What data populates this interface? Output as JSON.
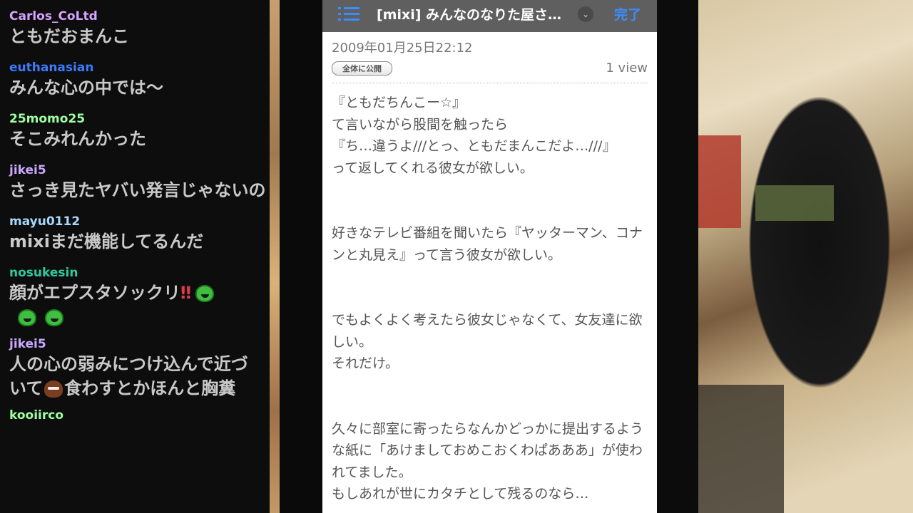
{
  "chat": {
    "messages": [
      {
        "user": "Carlos_CoLtd",
        "color": "#d6a3ff",
        "text": "ともだおまんこ"
      },
      {
        "user": "euthanasian",
        "color": "#3a7bff",
        "text": "みんな心の中では〜"
      },
      {
        "user": "25momo25",
        "color": "#9dffa0",
        "text": "そこみれんかった"
      },
      {
        "user": "jikei5",
        "color": "#c9a8ff",
        "text": "さっき見たヤバい発言じゃないの"
      },
      {
        "user": "mayu0112",
        "color": "#a8d8ff",
        "text": "mixiまだ機能してるんだ"
      },
      {
        "user": "nosukesin",
        "color": "#2fc9a0",
        "text": "顔がエプスタソックリ"
      },
      {
        "user": "jikei5",
        "color": "#c9a8ff",
        "text_a": "人の心の弱みにつけ込んで近づ",
        "text_b": "いて",
        "text_c": "食わすとかほんと胸糞"
      },
      {
        "user": "kooiirco",
        "color": "#9dffa0",
        "text": ""
      }
    ],
    "emote_name": "laughing-green-emote",
    "bang": "‼"
  },
  "phone": {
    "title": "[mixi] みんなのなりた屋さ…",
    "done_label": "完了",
    "date": "2009年01月25日22:12",
    "badge": "全体に公開",
    "views": "1 view",
    "accent": "#3c8cff",
    "paragraphs": [
      "『ともだちんこー☆』\nて言いながら股間を触ったら\n『ち…違うよ///とっ、ともだまんこだよ…///』\nって返してくれる彼女が欲しい。",
      "好きなテレビ番組を聞いたら『ヤッターマン、コナンと丸見え』って言う彼女が欲しい。",
      "でもよくよく考えたら彼女じゃなくて、女友達に欲しい。\nそれだけ。",
      "久々に部室に寄ったらなんかどっかに提出するような紙に「あけましておめこおくわぱあああ」が使われてました。\nもしあれが世にカタチとして残るのなら…"
    ]
  }
}
